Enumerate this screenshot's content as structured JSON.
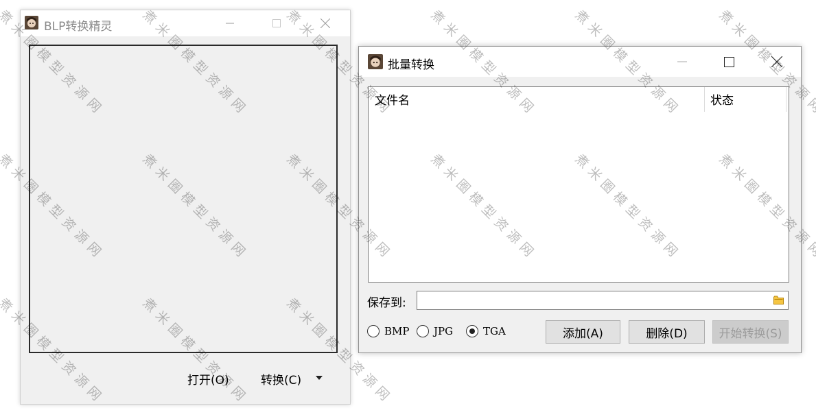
{
  "main_window": {
    "title": "BLP转换精灵",
    "open_button": "打开(O)",
    "convert_button": "转换(C)"
  },
  "batch_window": {
    "title": "批量转换",
    "list": {
      "columns": [
        "文件名",
        "状态"
      ]
    },
    "save_to_label": "保存到:",
    "save_path_value": "",
    "formats": [
      {
        "label": "BMP",
        "selected": false
      },
      {
        "label": "JPG",
        "selected": false
      },
      {
        "label": "TGA",
        "selected": true
      }
    ],
    "buttons": {
      "add": "添加(A)",
      "delete": "删除(D)",
      "start": "开始转换(S)"
    }
  },
  "watermark": "煮米圈模型资源网",
  "colors": {
    "window_bg": "#f0f0f0",
    "titlebar_bg": "#ffffff",
    "button_bg": "#e1e1e1",
    "disabled_text": "#9b9b9b"
  }
}
